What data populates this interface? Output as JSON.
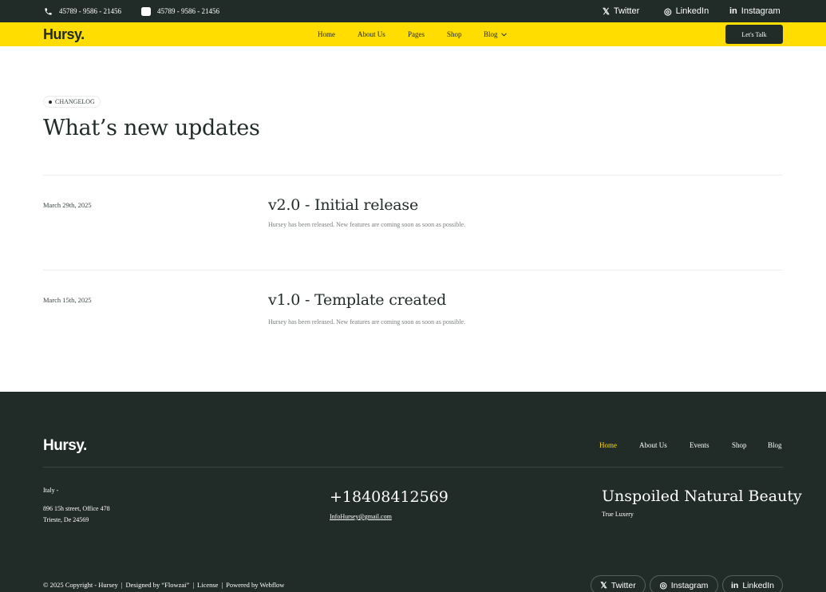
{
  "topbar": {
    "phone1": "45789 - 9586 - 21456",
    "phone2": "45789 - 9586 - 21456",
    "social": [
      {
        "icon": "x-icon",
        "glyph": "𝕏",
        "label": "Twitter"
      },
      {
        "icon": "instagram-icon",
        "glyph": "◎",
        "label": "LinkedIn"
      },
      {
        "icon": "linkedin-icon",
        "glyph": "in",
        "label": "Instagram"
      }
    ]
  },
  "nav": {
    "logo": "Hursy.",
    "items": [
      "Home",
      "About Us",
      "Pages",
      "Shop",
      "Blog"
    ],
    "cta": "Let's Talk"
  },
  "hero": {
    "badge": "CHANGELOG",
    "title": "What’s new updates"
  },
  "entries": [
    {
      "date": "March 29th, 2025",
      "title": "v2.0 - Initial release",
      "desc": "Hursey has been released. New features are coming soon as soon as possible."
    },
    {
      "date": "March 15th, 2025",
      "title": "v1.0 - Template created",
      "desc": "Hursey has been released. New features are coming soon as soon as possible."
    }
  ],
  "footer": {
    "logo": "Hursy.",
    "menu": [
      "Home",
      "About Us",
      "Events",
      "Shop",
      "Blog"
    ],
    "address_country": "Italy -",
    "address_line1": "896 15h street, Office 478",
    "address_line2": "Trieste, De 24569",
    "phone": "+18408412569",
    "email": "InfoHursey@gmail.com",
    "tagline": "Unspoiled Natural Beauty",
    "subtagline": "True Luxery",
    "copyright": "© 2025 Copyright - Hursey",
    "designed": "Designed by “Flowzai”",
    "license": "License",
    "powered": "Powered by Webflow",
    "social": [
      {
        "icon": "x-icon",
        "glyph": "𝕏",
        "label": "Twitter"
      },
      {
        "icon": "instagram-icon",
        "glyph": "◎",
        "label": "Instagram"
      },
      {
        "icon": "linkedin-icon",
        "glyph": "in",
        "label": "LinkedIn"
      }
    ],
    "active_color": "#ffdd00"
  }
}
